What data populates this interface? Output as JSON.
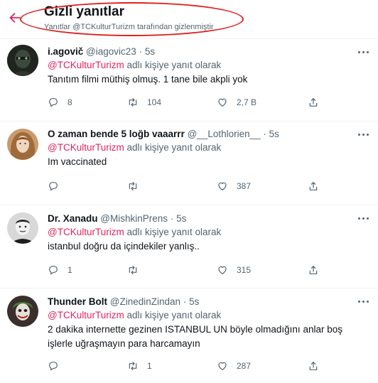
{
  "header": {
    "title": "Gizli yanıtlar",
    "subtitle": "Yanıtlar @TCKulturTurizm tarafından gizlenmiştir"
  },
  "colors": {
    "accent": "#e0245e",
    "muted": "#536471",
    "annotation": "#e0201e"
  },
  "tweets": [
    {
      "name": "i.agovič",
      "handle": "@iagovic23",
      "dot": "·",
      "time": "5s",
      "mention": "@TCKulturTurizm",
      "reply_suffix": " adlı kişiye yanıt olarak",
      "text": "Tanıtım filmi müthiş olmuş. 1 tane bile akpli yok",
      "reply_count": "8",
      "retweet_count": "104",
      "like_count": "2,7 B"
    },
    {
      "name": "O zaman bende 5 loğb vaaarrr",
      "handle": "@__Lothlorien__",
      "dot": "·",
      "time": "5s",
      "mention": "@TCKulturTurizm",
      "reply_suffix": " adlı kişiye yanıt olarak",
      "text": "Im vaccinated",
      "reply_count": "",
      "retweet_count": "",
      "like_count": "387"
    },
    {
      "name": "Dr. Xanadu",
      "handle": "@MishkinPrens",
      "dot": "·",
      "time": "5s",
      "mention": "@TCKulturTurizm",
      "reply_suffix": " adlı kişiye yanıt olarak",
      "text": "istanbul doğru da içindekiler yanlış..",
      "reply_count": "1",
      "retweet_count": "",
      "like_count": "315"
    },
    {
      "name": "Thunder Bolt",
      "handle": "@ZinedinZindan",
      "dot": "·",
      "time": "5s",
      "mention": "@TCKulturTurizm",
      "reply_suffix": " adlı kişiye yanıt olarak",
      "text": "2 dakika internette gezinen ISTANBUL UN böyle olmadığını anlar boş işlerle uğraşmayın para harcamayın",
      "reply_count": "",
      "retweet_count": "1",
      "like_count": "287"
    }
  ]
}
